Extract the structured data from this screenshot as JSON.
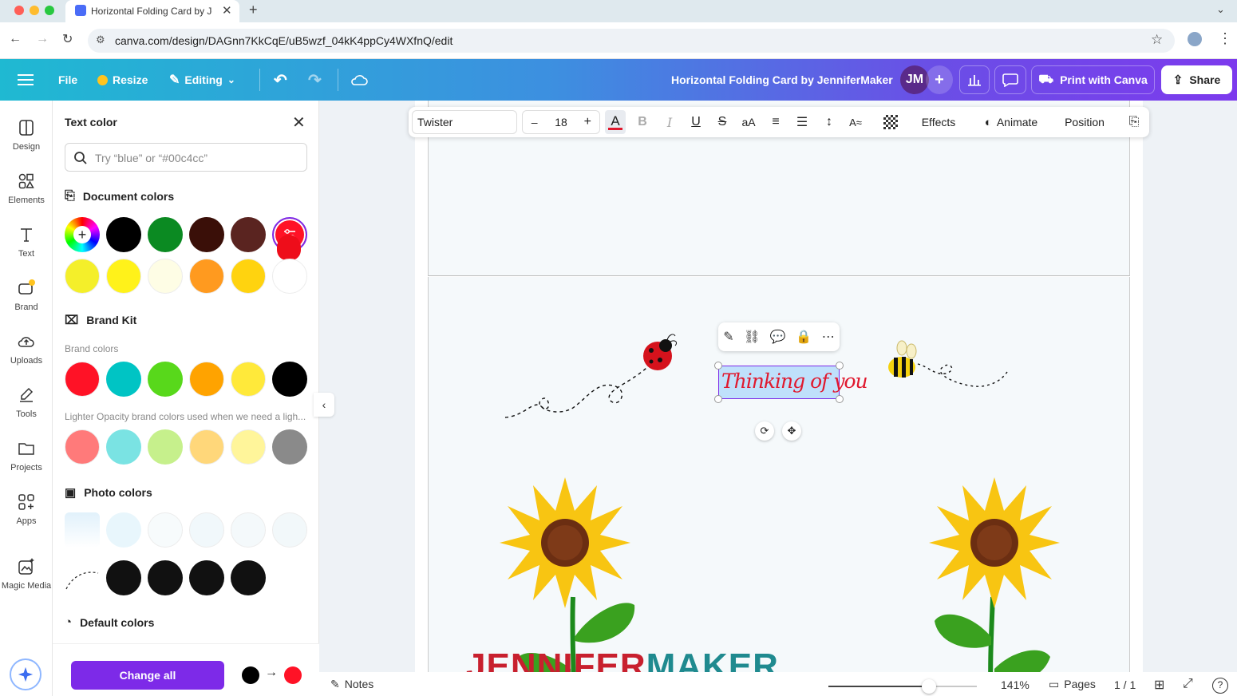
{
  "browser": {
    "tab_title": "Horizontal Folding Card by Je",
    "url": "canva.com/design/DAGnn7KkCqE/uB5wzf_04kK4ppCy4WXfnQ/edit"
  },
  "topbar": {
    "file": "File",
    "resize": "Resize",
    "editing": "Editing",
    "doc_title": "Horizontal Folding Card by JenniferMaker",
    "avatar": "JM",
    "print": "Print with Canva",
    "share": "Share"
  },
  "rail": [
    {
      "label": "Design",
      "icon": "design-icon"
    },
    {
      "label": "Elements",
      "icon": "elements-icon"
    },
    {
      "label": "Text",
      "icon": "text-icon"
    },
    {
      "label": "Brand",
      "icon": "brand-icon"
    },
    {
      "label": "Uploads",
      "icon": "uploads-icon"
    },
    {
      "label": "Tools",
      "icon": "tools-icon"
    },
    {
      "label": "Projects",
      "icon": "projects-icon"
    },
    {
      "label": "Apps",
      "icon": "apps-icon"
    },
    {
      "label": "Magic Media",
      "icon": "magic-media-icon"
    }
  ],
  "panel": {
    "title": "Text color",
    "search_placeholder": "Try “blue” or “#00c4cc”",
    "document_colors": "Document colors",
    "brand_kit": "Brand Kit",
    "brand_colors": "Brand colors",
    "lighter": "Lighter Opacity brand colors used when we need a ligh...",
    "photo_colors": "Photo colors",
    "default_colors": "Default colors",
    "change_all": "Change all",
    "doc_row1": [
      "#000000",
      "#0b8a22",
      "#3a0f08",
      "#5a2420",
      "#ffffff"
    ],
    "doc_row2": [
      "#f4ef2a",
      "#fff21a",
      "#fefde5",
      "#ff9a1f",
      "#ffd30f",
      "#ffffff"
    ],
    "brand_row": [
      "#ff1226",
      "#00c4c4",
      "#58d81b",
      "#ffa300",
      "#ffe93a",
      "#000000"
    ],
    "light_row": [
      "#ff7a7a",
      "#7ae3e3",
      "#c6f08c",
      "#ffd77a",
      "#fff59a",
      "#8a8a8a"
    ],
    "photo_row1": [
      "#e8f6fc",
      "#f7fbfc",
      "#f1f8fb",
      "#f4f9fb",
      "#f2f8fa"
    ],
    "photo_row2": [
      "#111111",
      "#111111",
      "#111111",
      "#111111"
    ],
    "change_from": "#000000",
    "change_to": "#ff1226"
  },
  "format": {
    "font": "Twister",
    "size": "18",
    "effects": "Effects",
    "animate": "Animate",
    "position": "Position",
    "text_color": "#e0192e"
  },
  "canvas": {
    "text": "Thinking of you",
    "watermark_1": "JENNIFER",
    "watermark_2": "MAKER"
  },
  "bottom": {
    "notes": "Notes",
    "zoom": "141%",
    "zoom_level": 0.68,
    "pages": "Pages",
    "page_count": "1 / 1"
  }
}
